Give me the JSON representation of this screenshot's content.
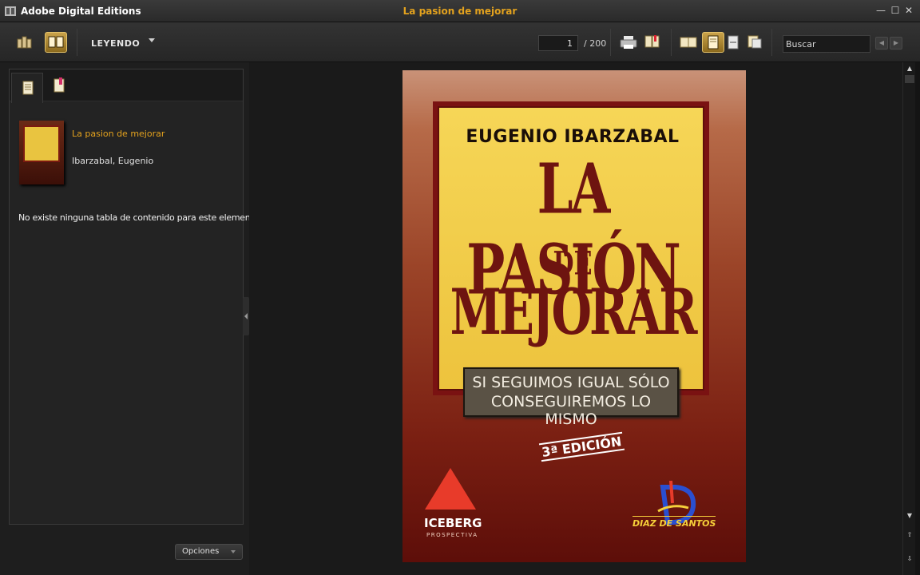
{
  "window": {
    "app_title": "Adobe Digital Editions",
    "doc_title": "La pasion de mejorar",
    "minimize": "—",
    "maximize": "☐",
    "close": "✕"
  },
  "toolbar": {
    "mode_label": "LEYENDO",
    "current_page": "1",
    "total_pages": "/ 200",
    "search_placeholder": "Buscar",
    "icons": [
      "library-icon",
      "reading-view-icon",
      "print-icon",
      "bookmark-page-icon",
      "two-page-icon",
      "single-page-icon",
      "fit-width-icon",
      "fit-page-icon",
      "search-prev-icon",
      "search-next-icon"
    ]
  },
  "sidebar": {
    "tabs": [
      "toc-tab",
      "bookmarks-tab"
    ],
    "book_title": "La pasion de mejorar",
    "book_author": "Ibarzabal, Eugenio",
    "no_toc_message": "No existe ninguna tabla de contenido para este elemento",
    "options_label": "Opciones"
  },
  "cover": {
    "author": "EUGENIO IBARZABAL",
    "line1": "LA PASIÓN",
    "line2": "DE",
    "line3": "MEJORAR",
    "subtitle1": "SI SEGUIMOS IGUAL SÓLO",
    "subtitle2": "CONSEGUIREMOS LO MISMO",
    "edition": "3ª EDICIÓN",
    "publisher1": "ICEBERG",
    "publisher1_sub": "PROSPECTIVA",
    "publisher2": "DIAZ DE SANTOS"
  },
  "colors": {
    "accent": "#e3a21e",
    "active_button": "#c9a24a"
  }
}
